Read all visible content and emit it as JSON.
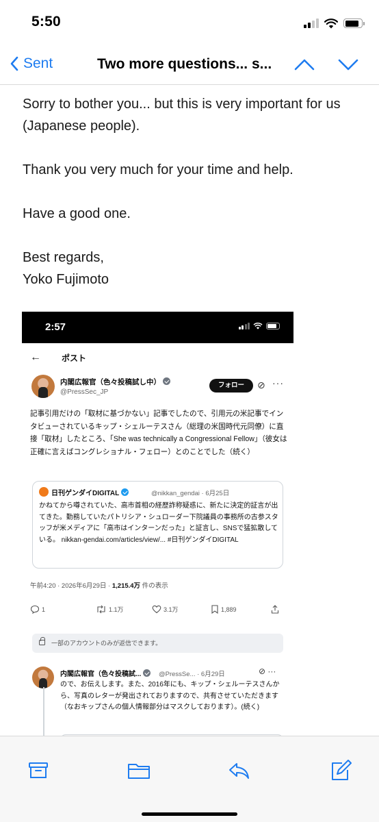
{
  "status_bar": {
    "time": "5:50"
  },
  "nav": {
    "back_label": "Sent",
    "title": "Two more questions... s..."
  },
  "email": {
    "paragraphs": [
      "Sorry to bother you... but this is very important for us (Japanese people).",
      "Thank you very much for your time and help.",
      "Have a good one.",
      "Best regards,",
      "Yoko Fujimoto"
    ]
  },
  "embedded_screenshot": {
    "status_time": "2:57",
    "header_title": "ポスト",
    "post": {
      "author_name": "内閣広報官（色々投稿試し中）",
      "author_handle": "@PressSec_JP",
      "follow_label": "フォロー",
      "text": "記事引用だけの「取材に基づかない」記事でしたので、引用元の米記事でインタビューされているキップ・シェルーテスさん（総理の米国時代元同僚）に直接「取材」したところ、「She was technically a Congressional Fellow」（彼女は正確に言えばコングレショナル・フェロー）とのことでした（続く）",
      "quote": {
        "name": "日刊ゲンダイDIGITAL",
        "handle": "@nikkan_gendai · 6月25日",
        "text": "かねてから噂されていた、高市首相の経歴詐称疑惑に、新たに決定的証言が出てきた。勤務していたパトリシア・シュローダー下院議員の事務所の古参スタッフが米メディアに「高市はインターンだった」と証言し、SNSで猛拡散している。 nikkan-gendai.com/articles/view/... #日刊ゲンダイDIGITAL"
      },
      "meta_time": "午前4:20 · 2026年6月29日 · ",
      "meta_views": "1,215.4万",
      "meta_views_suffix": " 件の表示",
      "actions": {
        "replies": "1",
        "reposts": "1.1万",
        "likes": "3.1万",
        "bookmarks": "1,889"
      },
      "reply_restriction": "一部のアカウントのみが返信できます。"
    },
    "reply": {
      "author_name": "内閣広報官（色々投稿試...",
      "handle": "@PressSe... · 6月29日",
      "text": "ので、お伝えします。また、2016年にも、キップ・シェルーテスさんから、写真のレターが発出されておりますので、共有させていただきます（なおキップさんの個人情報部分はマスクしております）。(続く)"
    }
  },
  "toolbar": {
    "items": [
      "archive",
      "move-to-folder",
      "reply",
      "compose"
    ]
  },
  "colors": {
    "accent": "#1e7cf0",
    "toolbar_bg": "#f7f7f7"
  }
}
